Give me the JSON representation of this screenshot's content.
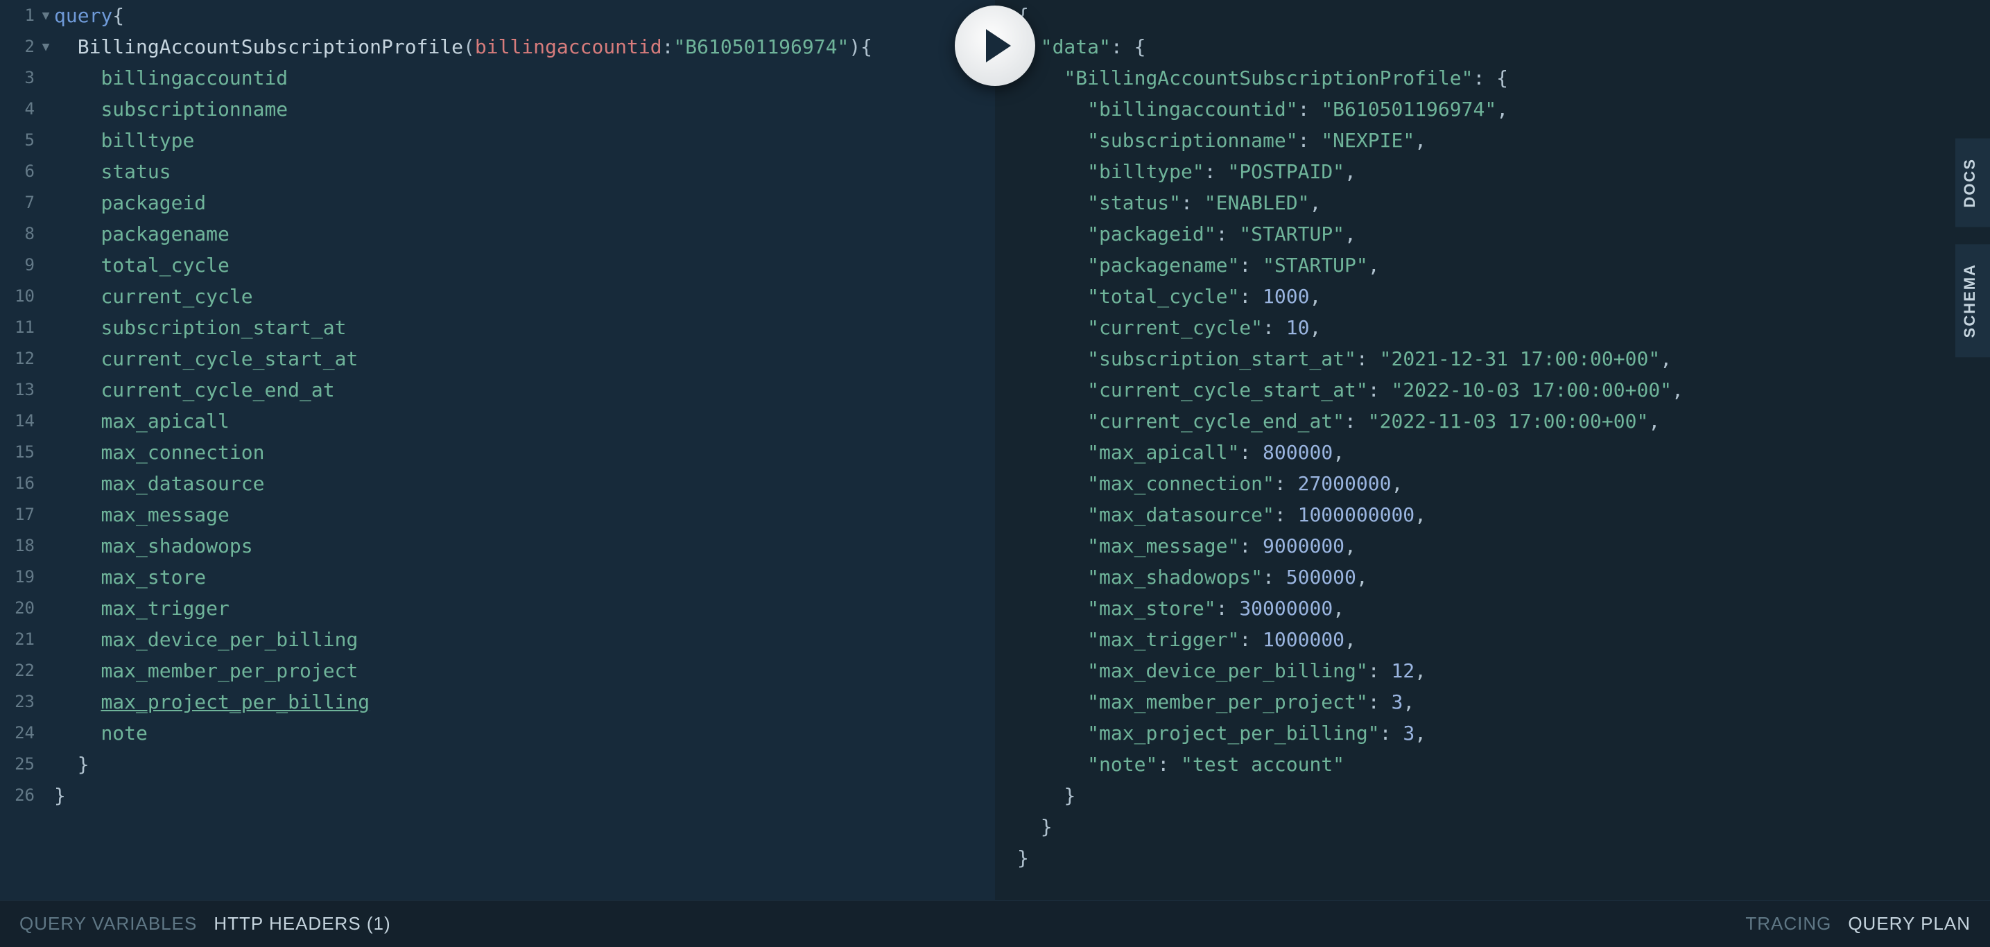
{
  "query": {
    "keyword": "query",
    "operation": "BillingAccountSubscriptionProfile",
    "arg_name": "billingaccountid",
    "arg_value": "\"B610501196974\"",
    "fields": [
      "billingaccountid",
      "subscriptionname",
      "billtype",
      "status",
      "packageid",
      "packagename",
      "total_cycle",
      "current_cycle",
      "subscription_start_at",
      "current_cycle_start_at",
      "current_cycle_end_at",
      "max_apicall",
      "max_connection",
      "max_datasource",
      "max_message",
      "max_shadowops",
      "max_store",
      "max_trigger",
      "max_device_per_billing",
      "max_member_per_project",
      "max_project_per_billing",
      "note"
    ]
  },
  "response": {
    "root_key": "data",
    "op_key": "BillingAccountSubscriptionProfile",
    "fields": [
      {
        "k": "billingaccountid",
        "v": "\"B610501196974\"",
        "t": "str"
      },
      {
        "k": "subscriptionname",
        "v": "\"NEXPIE\"",
        "t": "str"
      },
      {
        "k": "billtype",
        "v": "\"POSTPAID\"",
        "t": "str"
      },
      {
        "k": "status",
        "v": "\"ENABLED\"",
        "t": "str"
      },
      {
        "k": "packageid",
        "v": "\"STARTUP\"",
        "t": "str"
      },
      {
        "k": "packagename",
        "v": "\"STARTUP\"",
        "t": "str"
      },
      {
        "k": "total_cycle",
        "v": "1000",
        "t": "num"
      },
      {
        "k": "current_cycle",
        "v": "10",
        "t": "num"
      },
      {
        "k": "subscription_start_at",
        "v": "\"2021-12-31 17:00:00+00\"",
        "t": "str"
      },
      {
        "k": "current_cycle_start_at",
        "v": "\"2022-10-03 17:00:00+00\"",
        "t": "str"
      },
      {
        "k": "current_cycle_end_at",
        "v": "\"2022-11-03 17:00:00+00\"",
        "t": "str"
      },
      {
        "k": "max_apicall",
        "v": "800000",
        "t": "num"
      },
      {
        "k": "max_connection",
        "v": "27000000",
        "t": "num"
      },
      {
        "k": "max_datasource",
        "v": "1000000000",
        "t": "num"
      },
      {
        "k": "max_message",
        "v": "9000000",
        "t": "num"
      },
      {
        "k": "max_shadowops",
        "v": "500000",
        "t": "num"
      },
      {
        "k": "max_store",
        "v": "30000000",
        "t": "num"
      },
      {
        "k": "max_trigger",
        "v": "1000000",
        "t": "num"
      },
      {
        "k": "max_device_per_billing",
        "v": "12",
        "t": "num"
      },
      {
        "k": "max_member_per_project",
        "v": "3",
        "t": "num"
      },
      {
        "k": "max_project_per_billing",
        "v": "3",
        "t": "num"
      },
      {
        "k": "note",
        "v": "\"test account\"",
        "t": "str"
      }
    ]
  },
  "footer": {
    "query_variables": "QUERY VARIABLES",
    "http_headers": "HTTP HEADERS (1)",
    "tracing": "TRACING",
    "query_plan": "QUERY PLAN"
  },
  "side": {
    "docs": "DOCS",
    "schema": "SCHEMA"
  }
}
